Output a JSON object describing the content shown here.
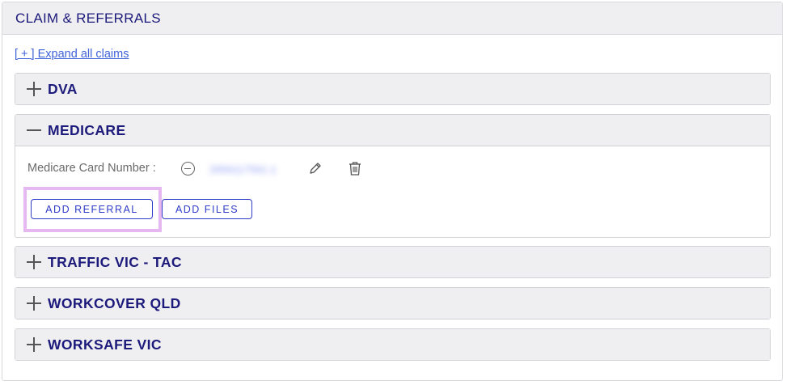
{
  "section": {
    "title": "CLAIM & REFERRALS"
  },
  "expand_link": "[ + ] Expand all claims",
  "claims": [
    {
      "title": "DVA",
      "state": "collapsed"
    },
    {
      "title": "MEDICARE",
      "state": "expanded",
      "card_label": "Medicare Card Number :",
      "card_value": "2956117561-1",
      "add_referral": "ADD REFERRAL",
      "add_files": "ADD FILES"
    },
    {
      "title": "TRAFFIC VIC - TAC",
      "state": "collapsed"
    },
    {
      "title": "WORKCOVER QLD",
      "state": "collapsed"
    },
    {
      "title": "WORKSAFE VIC",
      "state": "collapsed"
    }
  ],
  "icons": {
    "collapsed": "plus-icon",
    "expanded": "minus-icon",
    "remove": "minus-circle-icon",
    "edit": "pencil-icon",
    "delete": "trash-icon"
  },
  "colors": {
    "heading": "#1c1a7a",
    "link": "#3f63d8",
    "button": "#2f3bc9",
    "highlight": "#e6b8f2"
  }
}
